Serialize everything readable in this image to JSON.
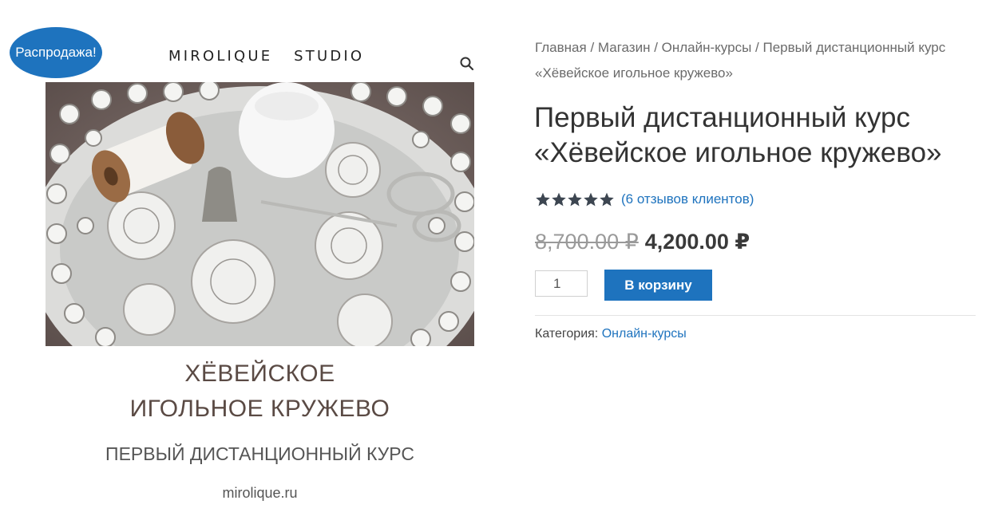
{
  "badge": {
    "sale_label": "Распродажа!"
  },
  "header": {
    "brand": "MIROLIQUE   STUDIO"
  },
  "gallery": {
    "caption_title_line1": "ХЁВЕЙСКОЕ",
    "caption_title_line2": "ИГОЛЬНОЕ КРУЖЕВО",
    "caption_subtitle": "ПЕРВЫЙ ДИСТАНЦИОННЫЙ КУРС",
    "caption_site": "mirolique.ru"
  },
  "breadcrumb": {
    "items": [
      "Главная",
      "Магазин",
      "Онлайн-курсы"
    ],
    "separator": " / ",
    "current": "Первый дистанционный курс «Хёвейское игольное кружево»"
  },
  "product": {
    "title": "Первый дистанционный курс «Хёвейское игольное кружево»",
    "rating_stars": 5,
    "reviews_label": "(6 отзывов клиентов)",
    "old_price": "8,700.00 ₽",
    "price": "4,200.00 ₽",
    "quantity": "1",
    "add_to_cart_label": "В корзину",
    "category_label": "Категория:",
    "category_value": "Онлайн-курсы"
  },
  "colors": {
    "accent": "#1e73be",
    "star": "#3d4651"
  }
}
